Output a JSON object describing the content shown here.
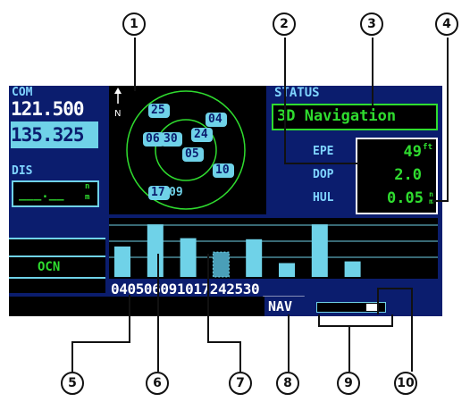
{
  "callouts": [
    "1",
    "2",
    "3",
    "4",
    "5",
    "6",
    "7",
    "8",
    "9",
    "10"
  ],
  "com": {
    "label": "COM",
    "active": "121.500",
    "standby": "135.325"
  },
  "dis": {
    "label": "DIS",
    "unit_top": "n",
    "unit_bot": "m",
    "value": "___.__"
  },
  "ocn": {
    "label": "OCN"
  },
  "sky": {
    "north_label": "N",
    "satellites": [
      {
        "prn": "25"
      },
      {
        "prn": "04"
      },
      {
        "prn": "06"
      },
      {
        "prn": "30"
      },
      {
        "prn": "24"
      },
      {
        "prn": "05"
      },
      {
        "prn": "10"
      },
      {
        "prn": "17"
      },
      {
        "prn": "09"
      }
    ]
  },
  "status": {
    "title": "STATUS",
    "mode": "3D Navigation",
    "epe_label": "EPE",
    "epe_value": "49",
    "dop_label": "DOP",
    "dop_value": "2.0",
    "hul_label": "HUL",
    "hul_value": "0.05"
  },
  "signal_bars": {
    "prns": "0405060910172425 30",
    "prn_string": "04050609101724253 0",
    "levels": [
      0.55,
      0.95,
      0.7,
      0.45,
      0.68,
      0.25,
      0.95,
      0.28,
      0.0,
      0.0
    ]
  },
  "bottom": {
    "nav_label": "NAV",
    "dashes": "_____"
  },
  "colors": {
    "bg": "#0b1d6e",
    "cyan": "#6fd2e8",
    "green": "#2fdc2f",
    "accent_text": "#ffffff"
  }
}
